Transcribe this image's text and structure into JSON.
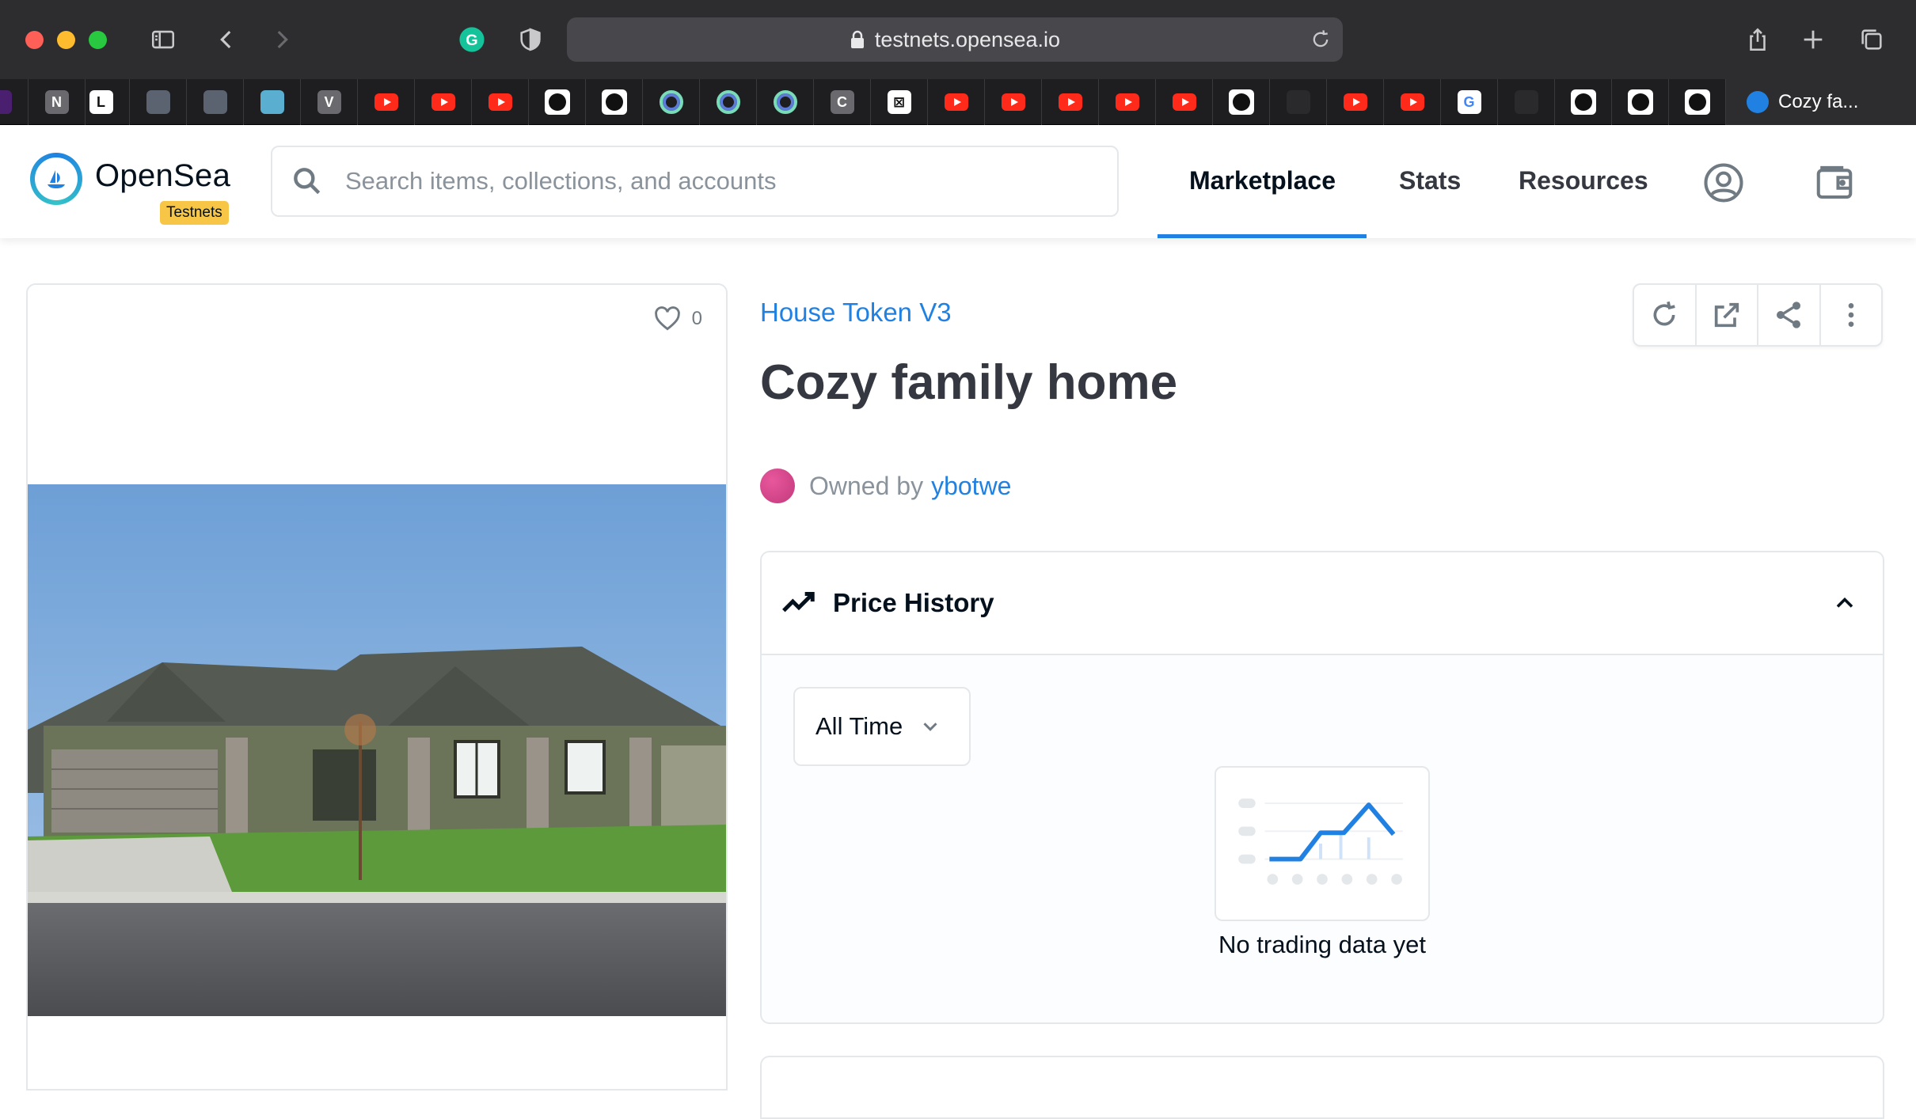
{
  "browser": {
    "url": "testnets.opensea.io",
    "active_tab_title": "Cozy fa...",
    "favicons": [
      "N",
      "V",
      "C"
    ]
  },
  "nav": {
    "brand": "OpenSea",
    "badge": "Testnets",
    "search_placeholder": "Search items, collections, and accounts",
    "links": [
      "Marketplace",
      "Stats",
      "Resources"
    ],
    "active_link": "Marketplace"
  },
  "item": {
    "favorites_count": "0",
    "collection": "House Token V3",
    "title": "Cozy family home",
    "owned_by_label": "Owned by",
    "owner": "ybotwe"
  },
  "price_history": {
    "title": "Price History",
    "time_filter": "All Time",
    "empty_message": "No trading data yet"
  },
  "colors": {
    "accent": "#2081e2",
    "badge": "#f7c646",
    "text": "#04111d"
  }
}
